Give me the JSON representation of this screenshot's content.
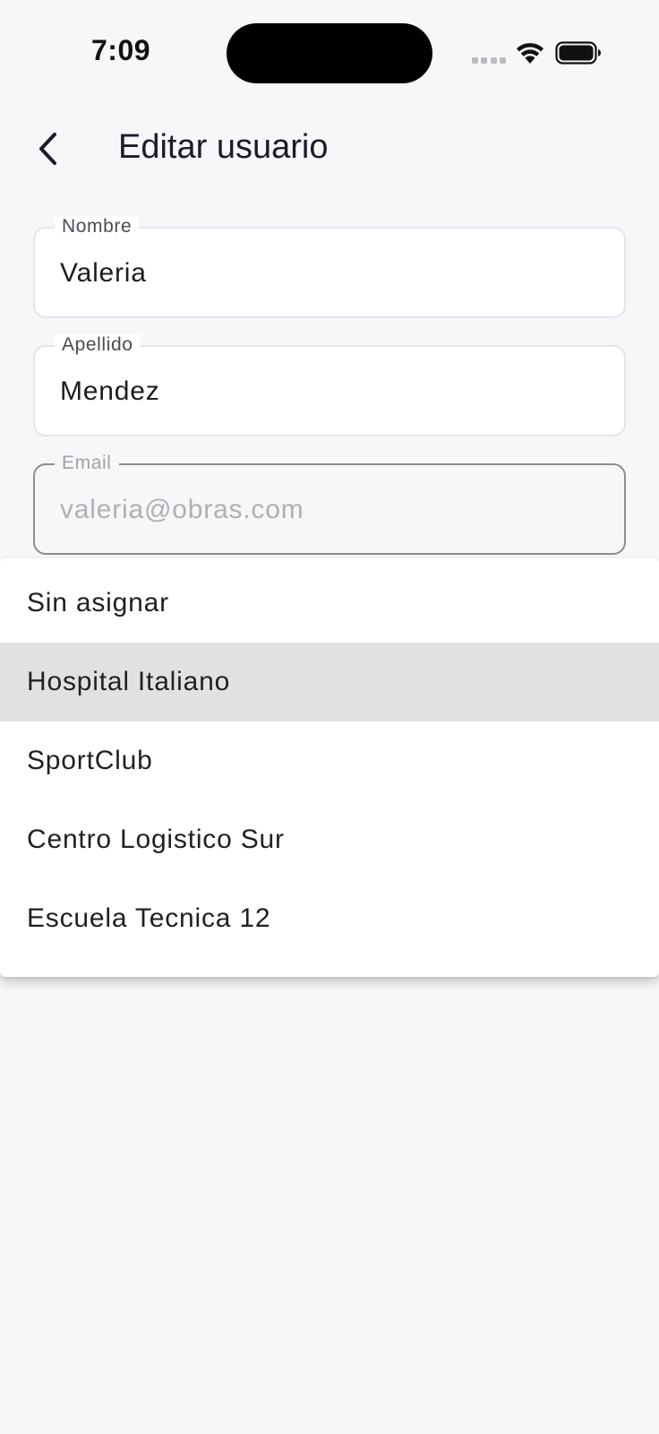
{
  "status_bar": {
    "time": "7:09"
  },
  "header": {
    "title": "Editar usuario"
  },
  "form": {
    "nombre": {
      "label": "Nombre",
      "value": "Valeria"
    },
    "apellido": {
      "label": "Apellido",
      "value": "Mendez"
    },
    "email": {
      "label": "Email",
      "value": "valeria@obras.com"
    }
  },
  "dropdown": {
    "options": [
      {
        "label": "Sin asignar",
        "highlighted": false
      },
      {
        "label": "Hospital Italiano",
        "highlighted": true
      },
      {
        "label": "SportClub",
        "highlighted": false
      },
      {
        "label": "Centro Logistico Sur",
        "highlighted": false
      },
      {
        "label": "Escuela Tecnica 12",
        "highlighted": false
      }
    ]
  },
  "icons": {
    "back": "chevron-left-icon",
    "wifi": "wifi-icon",
    "battery": "battery-icon",
    "signal": "cellular-signal-icon"
  },
  "colors": {
    "background": "#f6f7f9",
    "highlight": "#e1e1e1",
    "title": "#1a1c2a"
  }
}
